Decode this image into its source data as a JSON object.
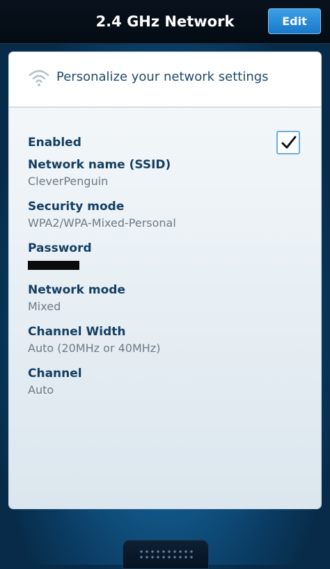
{
  "topbar": {
    "title": "2.4 GHz Network",
    "edit_label": "Edit"
  },
  "card": {
    "header_text": "Personalize your network settings",
    "header_icon": "wifi-icon",
    "enabled": {
      "label": "Enabled",
      "checked": true
    },
    "fields": [
      {
        "label": "Network name (SSID)",
        "value": "CleverPenguin"
      },
      {
        "label": "Security mode",
        "value": "WPA2/WPA-Mixed-Personal"
      },
      {
        "label": "Password",
        "value": ""
      },
      {
        "label": "Network mode",
        "value": "Mixed"
      },
      {
        "label": "Channel Width",
        "value": "Auto (20MHz or 40MHz)"
      },
      {
        "label": "Channel",
        "value": "Auto"
      }
    ]
  },
  "colors": {
    "accent": "#2a8ad6",
    "label": "#143f63",
    "value": "#6f7a83"
  }
}
